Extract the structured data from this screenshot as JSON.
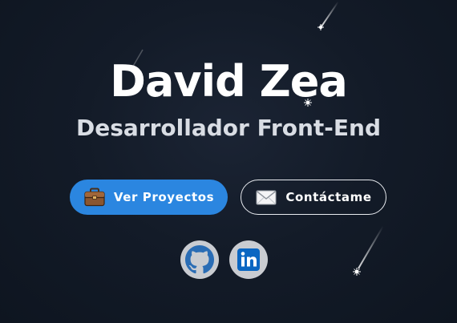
{
  "hero": {
    "name": "David Zea",
    "role": "Desarrollador Front-End"
  },
  "actions": {
    "projects_label": "Ver Proyectos",
    "contact_label": "Contáctame",
    "projects_icon": "briefcase-icon",
    "contact_icon": "envelope-icon"
  },
  "social": {
    "github_icon": "github-icon",
    "linkedin_icon": "linkedin-icon"
  },
  "colors": {
    "background": "#121a27",
    "primary_button": "#2b86e0",
    "social_bg": "#c9ccd1",
    "github_brand": "#2a6db5",
    "linkedin_brand": "#0a66c2"
  }
}
